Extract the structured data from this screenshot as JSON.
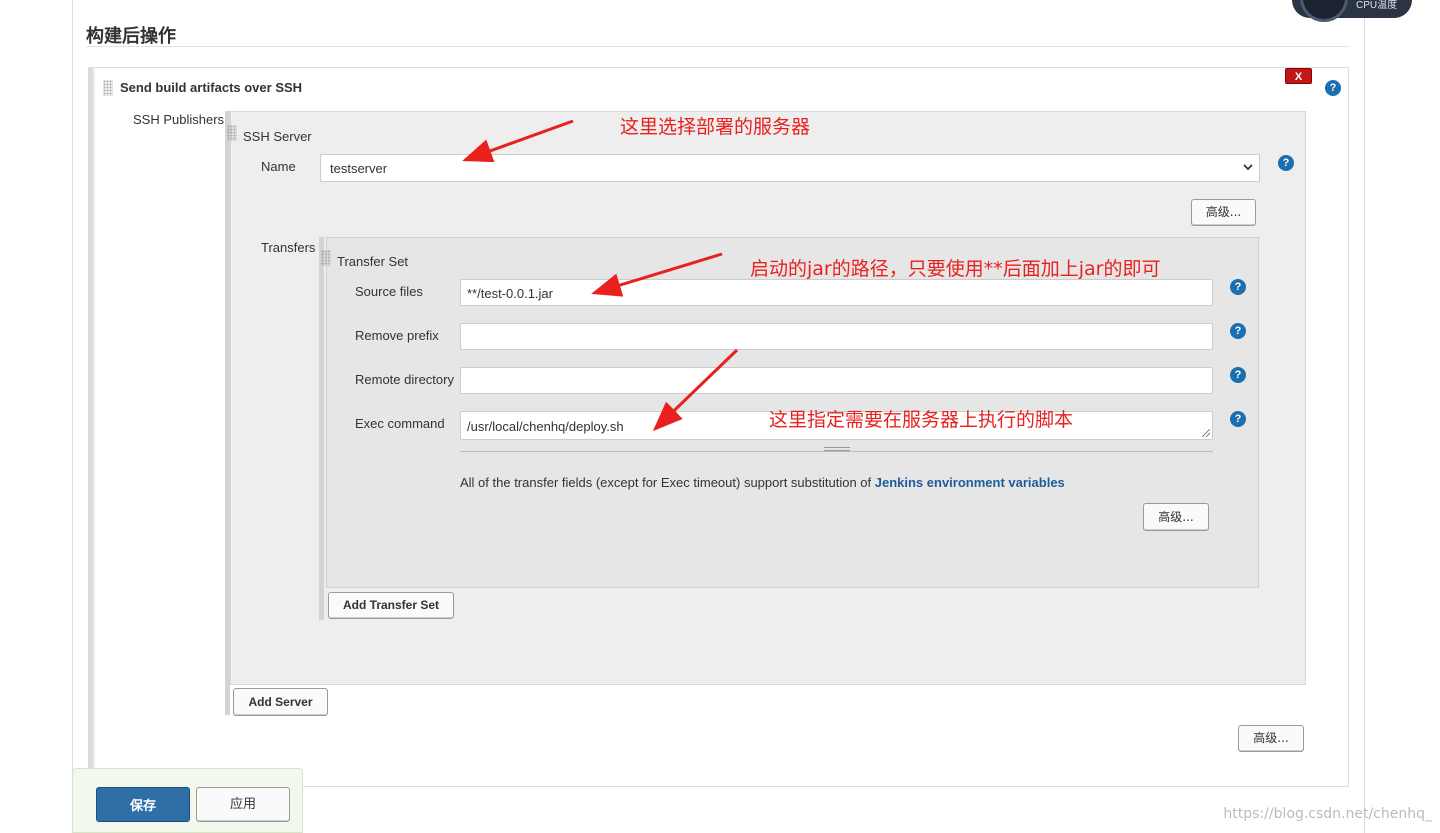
{
  "section": {
    "title": "构建后操作"
  },
  "block": {
    "title": "Send build artifacts over SSH",
    "delete_label": "X"
  },
  "ssh_publishers": {
    "label": "SSH Publishers"
  },
  "ssh_server": {
    "title": "SSH Server",
    "name_label": "Name",
    "name_value": "testserver",
    "advanced_label": "高级...",
    "transfers_label": "Transfers"
  },
  "transfer_set": {
    "title": "Transfer Set",
    "source_files_label": "Source files",
    "source_files_value": "**/test-0.0.1.jar",
    "remove_prefix_label": "Remove prefix",
    "remove_prefix_value": "",
    "remote_directory_label": "Remote directory",
    "remote_directory_value": "",
    "exec_command_label": "Exec command",
    "exec_command_value": "/usr/local/chenhq/deploy.sh",
    "env_note": "All of the transfer fields (except for Exec timeout) support substitution of ",
    "env_link": "Jenkins environment variables",
    "advanced_label": "高级..."
  },
  "buttons": {
    "add_transfer_set": "Add Transfer Set",
    "add_server": "Add Server",
    "outer_advanced": "高级...",
    "save": "保存",
    "apply": "应用"
  },
  "help_icon": "?",
  "annotations": {
    "server": "这里选择部署的服务器",
    "jar": "启动的jar的路径，只要使用**后面加上jar的即可",
    "exec": "这里指定需要在服务器上执行的脚本"
  },
  "watermark": "https://blog.csdn.net/chenhq_",
  "cpu_widget": "CPU温度",
  "colors": {
    "annotation": "#e8211f",
    "primary": "#2f6fa8",
    "delete": "#c01818",
    "help": "#1b6fb0"
  }
}
